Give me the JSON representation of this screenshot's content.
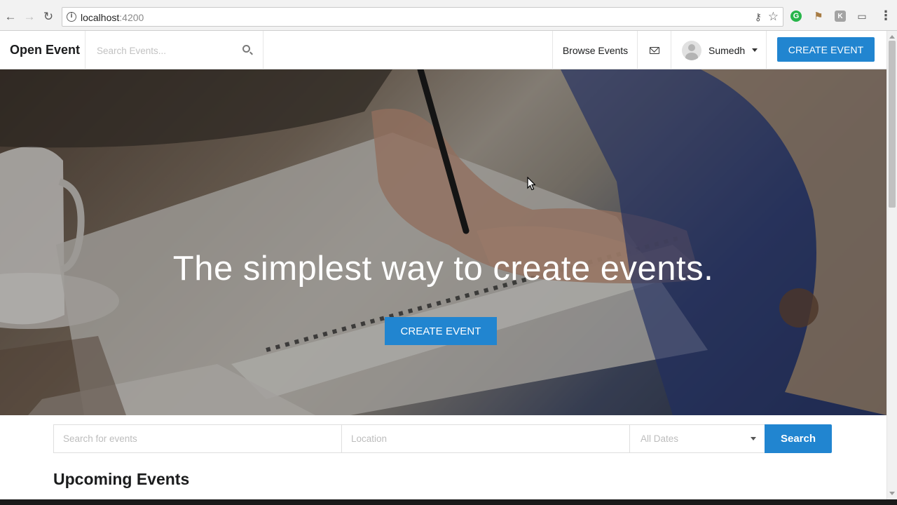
{
  "browser": {
    "url_host": "localhost",
    "url_port": ":4200",
    "icons": [
      "back-icon",
      "forward-icon",
      "reload-icon",
      "info-icon",
      "key-icon",
      "star-icon",
      "grammarly-icon",
      "bookmark-icon",
      "extension-icon",
      "cast-icon",
      "menu-icon"
    ]
  },
  "navbar": {
    "brand": "Open Event",
    "search_placeholder": "Search Events...",
    "browse_label": "Browse Events",
    "user_name": "Sumedh",
    "create_label": "CREATE EVENT"
  },
  "hero": {
    "title": "The simplest way to create events.",
    "create_label": "CREATE EVENT"
  },
  "search": {
    "events_placeholder": "Search for events",
    "location_placeholder": "Location",
    "dates_value": "All Dates",
    "button_label": "Search"
  },
  "section": {
    "upcoming_title": "Upcoming Events"
  },
  "colors": {
    "primary": "#2185d0",
    "chrome_bg": "#f2f2f2",
    "grammarly": "#27b54a"
  }
}
